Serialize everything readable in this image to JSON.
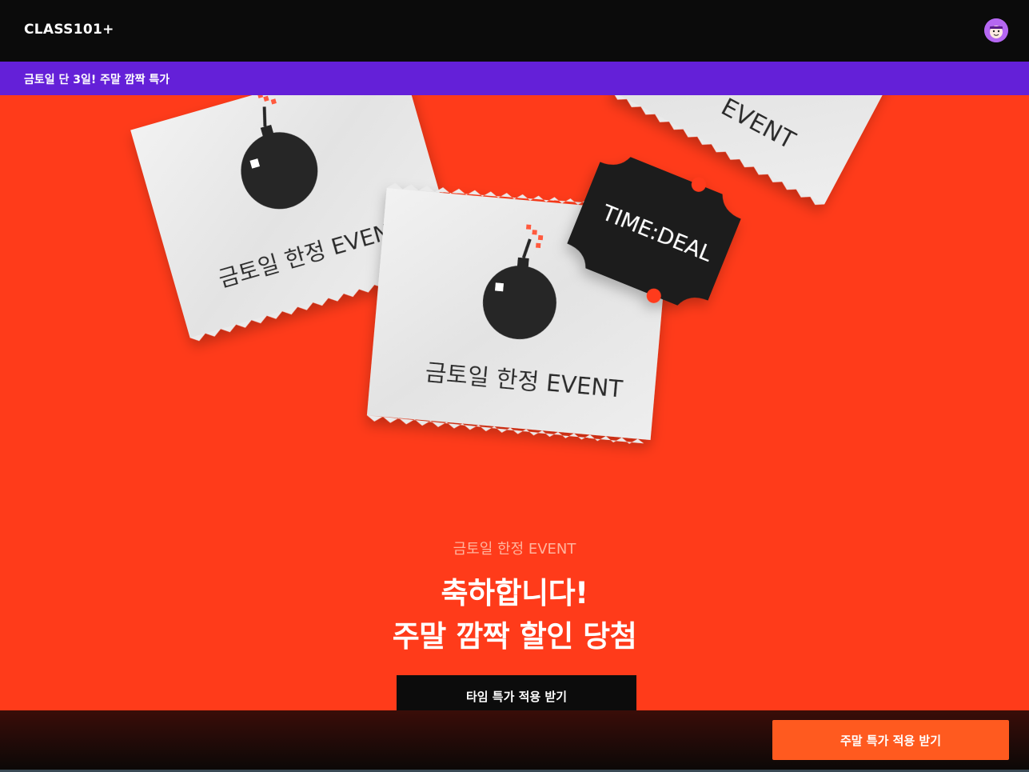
{
  "header": {
    "logo": "CLASS101+",
    "avatar_icon": "character-avatar-icon"
  },
  "banner": {
    "text": "금토일 단 3일! 주말 깜짝 특가"
  },
  "hero": {
    "cards": [
      {
        "text": "금토일 한정 EVENT"
      },
      {
        "text": "EVENT"
      },
      {
        "text": "금토일 한정 EVENT"
      }
    ],
    "ticket_text": "TIME:DEAL",
    "event_label": "금토일 한정 EVENT",
    "headline_line1": "축하합니다!",
    "headline_line2": "주말 깜짝 할인 당첨",
    "cta_label": "타임 특가 적용 받기"
  },
  "bottom_bar": {
    "cta_label": "주말 특가 적용 받기"
  },
  "colors": {
    "header_bg": "#0b0b0b",
    "banner_bg": "#6420d8",
    "hero_bg": "#ff3b1a",
    "cta_bg": "#0c0c0c",
    "bottom_cta_bg": "#ff5a1f",
    "card_bg": "#e9e9e9"
  }
}
